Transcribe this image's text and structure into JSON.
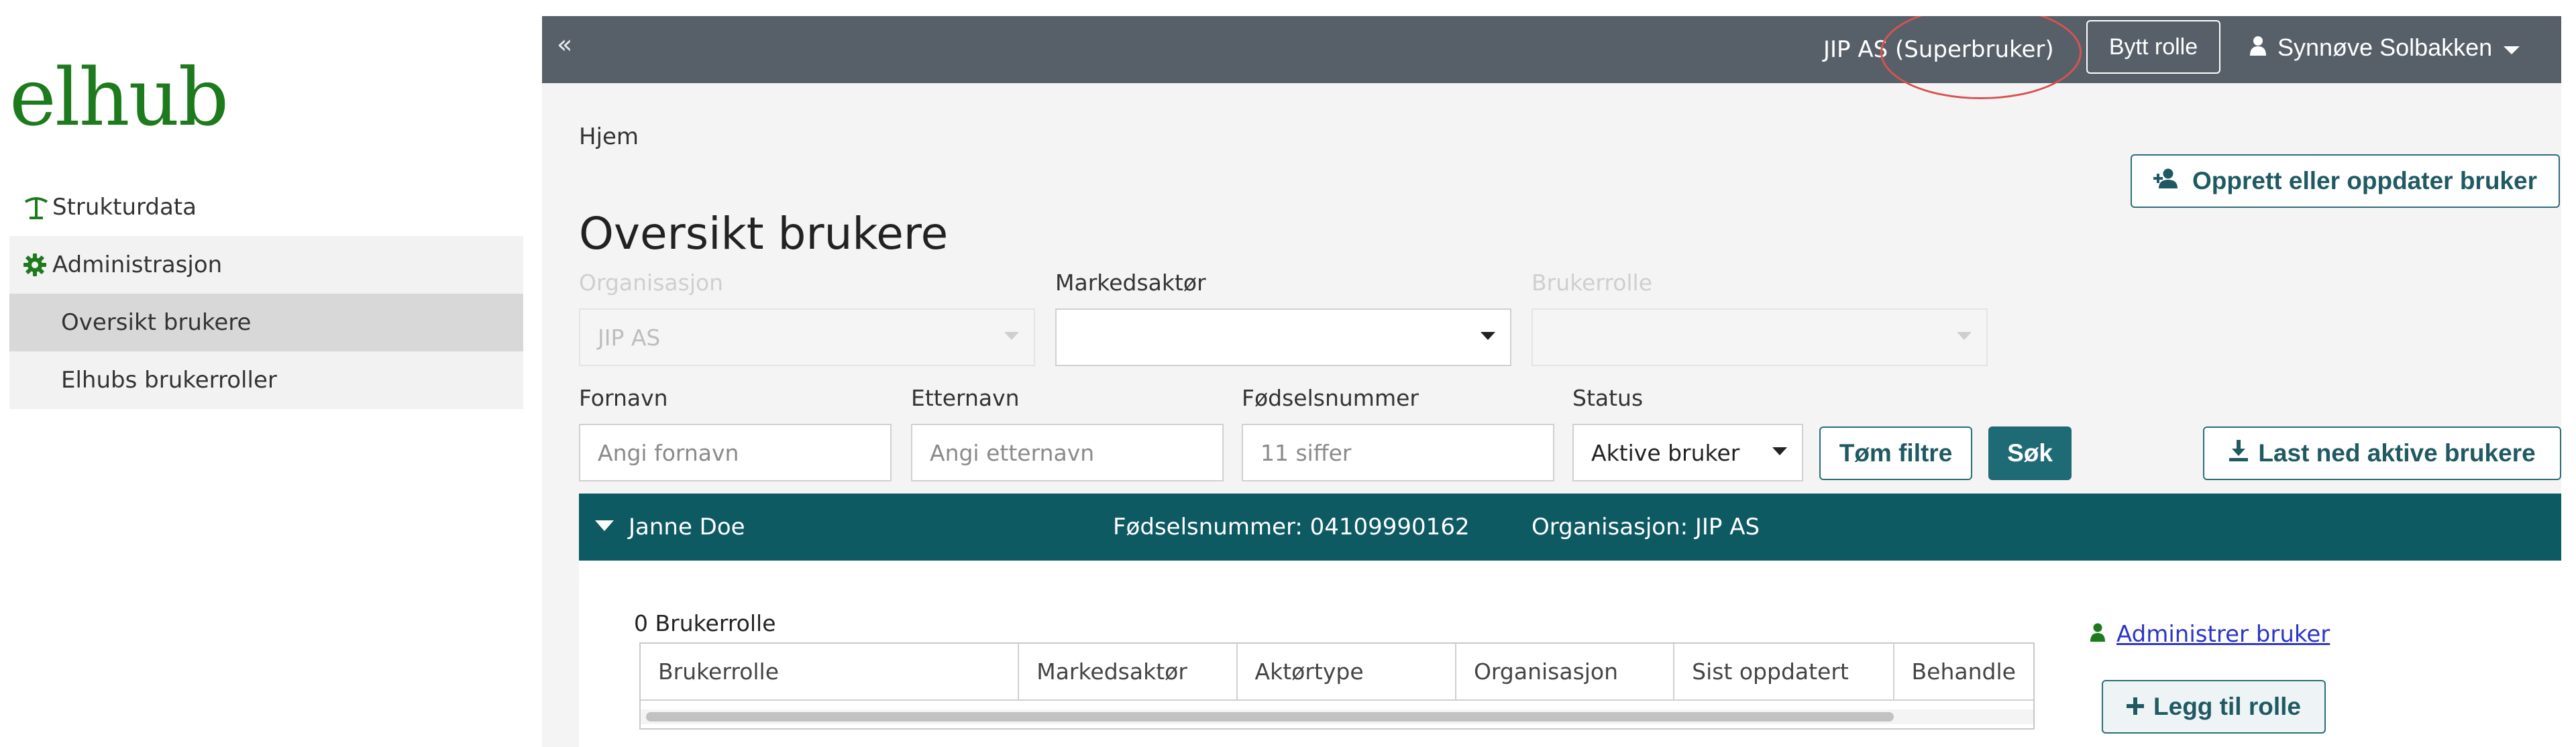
{
  "logo": {
    "text": "elhub",
    "color": "#1d7a1d"
  },
  "sidebar": {
    "items": [
      {
        "label": "Strukturdata",
        "icon": "tree-icon"
      },
      {
        "label": "Administrasjon",
        "icon": "gear-icon"
      },
      {
        "label": "Oversikt brukere"
      },
      {
        "label": "Elhubs brukerroller"
      }
    ]
  },
  "topbar": {
    "collapse_glyph": "«",
    "org_role": "JIP AS (Superbruker)",
    "switch_role_label": "Bytt rolle",
    "user_name": "Synnøve Solbakken",
    "background": "#576069"
  },
  "breadcrumb": "Hjem",
  "page_title": "Oversikt brukere",
  "create_button_label": "Opprett eller oppdater bruker",
  "filters": {
    "organization": {
      "label": "Organisasjon",
      "value": "JIP AS"
    },
    "market_actor": {
      "label": "Markedsaktør",
      "value": ""
    },
    "user_role": {
      "label": "Brukerrolle",
      "value": ""
    },
    "first_name": {
      "label": "Fornavn",
      "placeholder": "Angi fornavn"
    },
    "last_name": {
      "label": "Etternavn",
      "placeholder": "Angi etternavn"
    },
    "ssn": {
      "label": "Fødselsnummer",
      "placeholder": "11 siffer"
    },
    "status": {
      "label": "Status",
      "value": "Aktive bruker"
    },
    "clear_label": "Tøm filtre",
    "search_label": "Søk",
    "download_label": "Last ned aktive brukere"
  },
  "person": {
    "name": "Janne Doe",
    "ssn_text": "Fødselsnummer: 04109990162",
    "org_text": "Organisasjon: JIP AS",
    "role_count": "0 Brukerrolle",
    "columns": [
      "Brukerrolle",
      "Markedsaktør",
      "Aktørtype",
      "Organisasjon",
      "Sist oppdatert",
      "Behandle"
    ],
    "admin_link": "Administrer bruker",
    "add_role_label": "Legg til rolle",
    "bar_color": "#0e5a63"
  }
}
